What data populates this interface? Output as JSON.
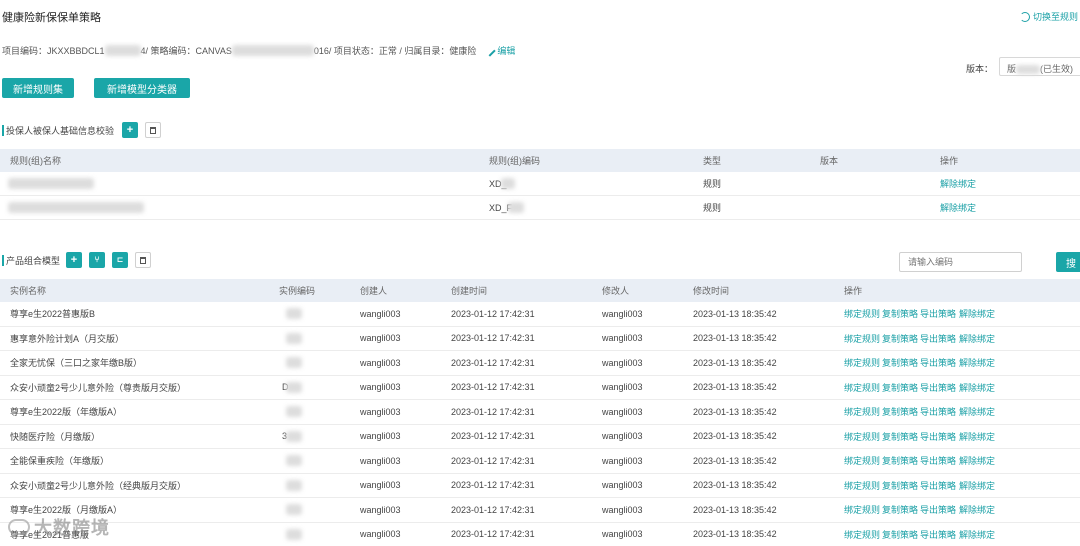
{
  "header": {
    "title": "健康险新保保单策略",
    "switch_label": "切换至规则",
    "switch_icon": "refresh-icon"
  },
  "meta": {
    "project_code_prefix": "项目编码：JKXXBBDCL1",
    "project_code_suffix": "4/ 策略编码：CANVAS",
    "strategy_code_suffix": "016/ 项目状态：正常 / 归属目录：健康险",
    "edit_label": "编辑",
    "edit_icon": "pencil-icon"
  },
  "version": {
    "label": "版本：",
    "value_prefix": "版",
    "value_suffix": "(已生效)"
  },
  "toolbar": {
    "add_ruleset": "新增规则集",
    "add_model_classifier": "新增模型分类器"
  },
  "section1": {
    "title": "投保人被保人基础信息校验",
    "columns": [
      "规则(组)名称",
      "规则(组)编码",
      "类型",
      "版本",
      "操作"
    ],
    "rows": [
      {
        "code": "XD_",
        "type": "规则",
        "action": "解除绑定"
      },
      {
        "code": "XD_F",
        "type": "规则",
        "action": "解除绑定"
      }
    ]
  },
  "section2": {
    "title": "产品组合模型",
    "search_placeholder": "请输入编码",
    "search_label": "搜",
    "columns": [
      "实例名称",
      "实例编码",
      "创建人",
      "创建时间",
      "修改人",
      "修改时间",
      "操作"
    ],
    "actions": [
      "绑定规则",
      "复制策略",
      "导出策略",
      "解除绑定"
    ],
    "rows": [
      {
        "name": "尊享e生2022普惠版B",
        "code": "",
        "creator": "wangli003",
        "created": "2023-01-12 17:42:31",
        "modifier": "wangli003",
        "modified": "2023-01-13 18:35:42"
      },
      {
        "name": "惠享意外险计划A（月交版）",
        "code": "",
        "creator": "wangli003",
        "created": "2023-01-12 17:42:31",
        "modifier": "wangli003",
        "modified": "2023-01-13 18:35:42"
      },
      {
        "name": "全家无忧保（三口之家年缴B版）",
        "code": "",
        "creator": "wangli003",
        "created": "2023-01-12 17:42:31",
        "modifier": "wangli003",
        "modified": "2023-01-13 18:35:42"
      },
      {
        "name": "众安小顽童2号少儿意外险（尊贵版月交版）",
        "code": "D",
        "creator": "wangli003",
        "created": "2023-01-12 17:42:31",
        "modifier": "wangli003",
        "modified": "2023-01-13 18:35:42"
      },
      {
        "name": "尊享e生2022版（年缴版A）",
        "code": "",
        "creator": "wangli003",
        "created": "2023-01-12 17:42:31",
        "modifier": "wangli003",
        "modified": "2023-01-13 18:35:42"
      },
      {
        "name": "快随医疗险（月缴版）",
        "code": "3",
        "creator": "wangli003",
        "created": "2023-01-12 17:42:31",
        "modifier": "wangli003",
        "modified": "2023-01-13 18:35:42"
      },
      {
        "name": "全能保重疾险（年缴版）",
        "code": "",
        "creator": "wangli003",
        "created": "2023-01-12 17:42:31",
        "modifier": "wangli003",
        "modified": "2023-01-13 18:35:42"
      },
      {
        "name": "众安小顽童2号少儿意外险（经典版月交版）",
        "code": "",
        "creator": "wangli003",
        "created": "2023-01-12 17:42:31",
        "modifier": "wangli003",
        "modified": "2023-01-13 18:35:42"
      },
      {
        "name": "尊享e生2022版（月缴版A）",
        "code": "",
        "creator": "wangli003",
        "created": "2023-01-12 17:42:31",
        "modifier": "wangli003",
        "modified": "2023-01-13 18:35:42"
      },
      {
        "name": "尊享e生2021普惠版",
        "code": "",
        "creator": "wangli003",
        "created": "2023-01-12 17:42:31",
        "modifier": "wangli003",
        "modified": "2023-01-13 18:35:42"
      }
    ]
  },
  "watermark": "大数跨境",
  "colors": {
    "accent": "#1aa6a8",
    "header_bg": "#e9eef5"
  }
}
